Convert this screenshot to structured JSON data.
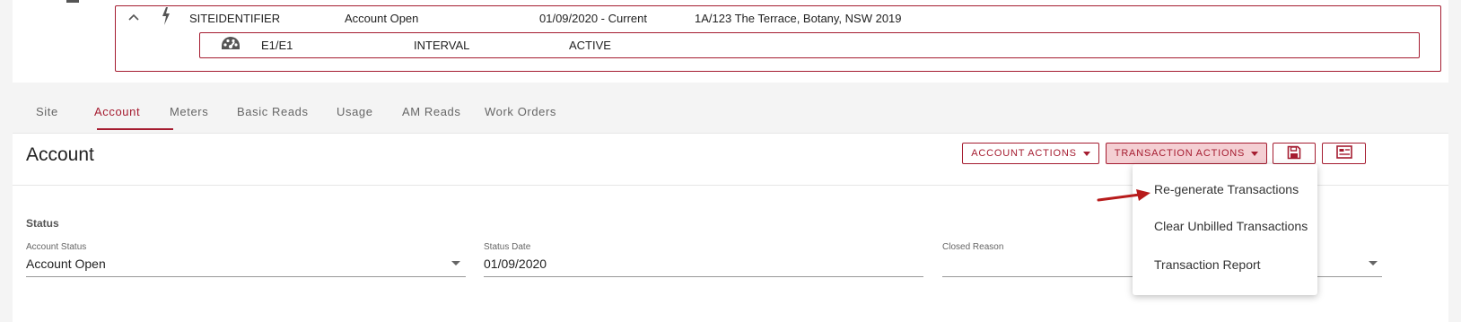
{
  "site": {
    "identifier": "SITEIDENTIFIER",
    "status": "Account Open",
    "period": "01/09/2020 - Current",
    "address": "1A/123 The Terrace, Botany, NSW 2019",
    "meter": {
      "id": "E1/E1",
      "type": "INTERVAL",
      "state": "ACTIVE"
    }
  },
  "tabs": [
    {
      "label": "Site"
    },
    {
      "label": "Account"
    },
    {
      "label": "Meters"
    },
    {
      "label": "Basic Reads"
    },
    {
      "label": "Usage"
    },
    {
      "label": "AM Reads"
    },
    {
      "label": "Work Orders"
    }
  ],
  "active_tab": "Account",
  "account": {
    "title": "Account",
    "account_actions_label": "ACCOUNT ACTIONS",
    "transaction_actions_label": "TRANSACTION ACTIONS",
    "status_section": "Status",
    "fields": {
      "account_status": {
        "label": "Account Status",
        "value": "Account Open"
      },
      "status_date": {
        "label": "Status Date",
        "value": "01/09/2020"
      },
      "closed_reason": {
        "label": "Closed Reason",
        "value": ""
      }
    }
  },
  "transaction_menu": {
    "items": [
      {
        "label": "Re-generate Transactions"
      },
      {
        "label": "Clear Unbilled Transactions"
      },
      {
        "label": "Transaction Report"
      }
    ]
  },
  "colors": {
    "accent": "#a51c30",
    "accent_light": "#f4cfd3",
    "background": "#f4f4f4"
  },
  "icons": [
    "chevron-up-icon",
    "lightning-icon",
    "gauge-icon",
    "save-icon",
    "form-icon",
    "caret-down-icon",
    "arrow-icon"
  ]
}
